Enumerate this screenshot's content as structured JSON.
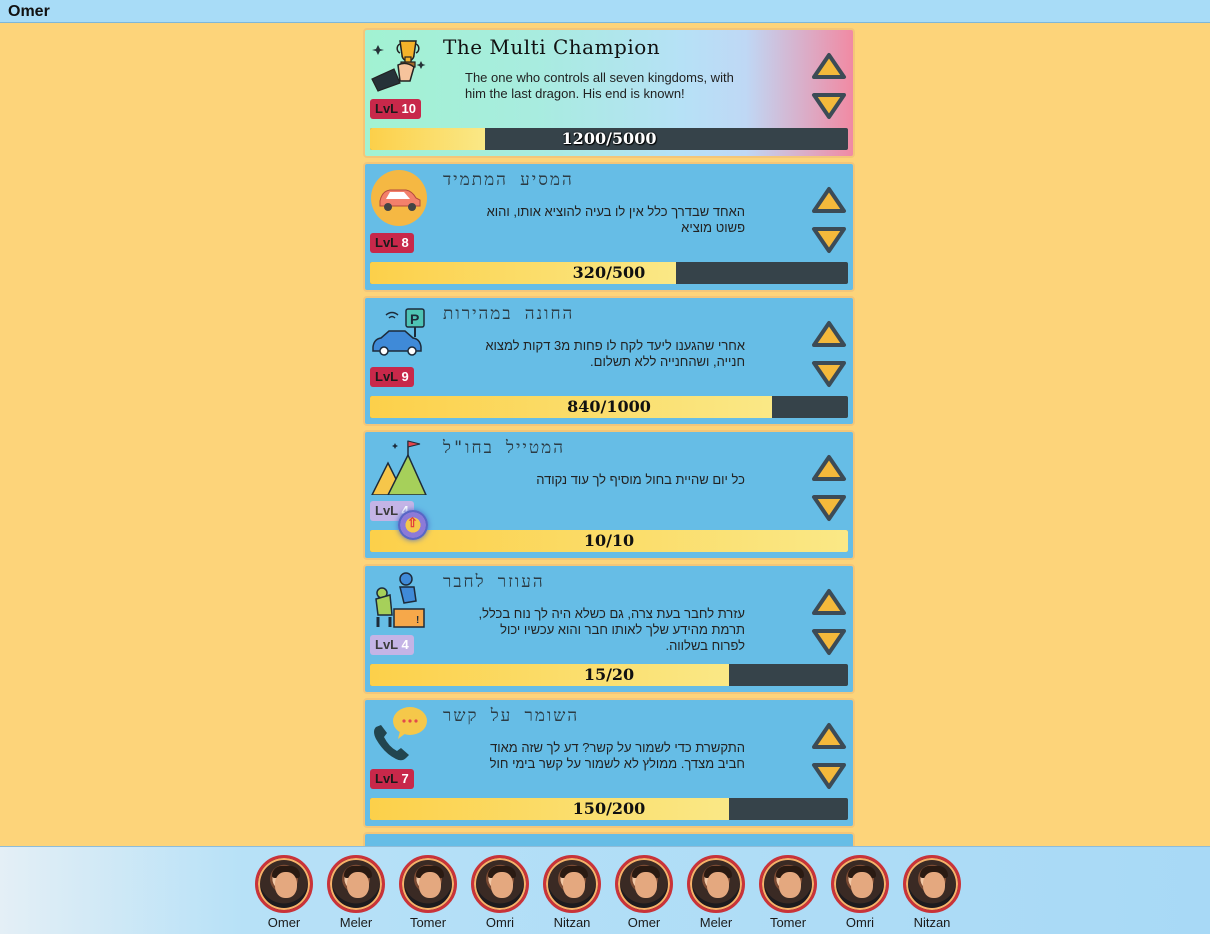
{
  "header": {
    "username": "Omer"
  },
  "achievements": [
    {
      "title": "The Multi Champion",
      "description": "The one who controls all seven kingdoms, with him the last dragon. His end is known!",
      "level_word": "LvL",
      "level": "10",
      "progress_text": "1200/5000",
      "progress": 0.24,
      "icon": "trophy-icon",
      "style": "champion"
    },
    {
      "title": "המסיע המתמיד",
      "description": "האחד שבדרך כלל אין לו בעיה להוציא אותו, והוא פשוט מוציא",
      "level_word": "LvL",
      "level": "8",
      "progress_text": "320/500",
      "progress": 0.64,
      "icon": "car-icon",
      "style": "normal"
    },
    {
      "title": "החונה במהירות",
      "description": "אחרי שהגענו ליעד לקח לו פחות מ3 דקות למצוא חנייה, ושהחנייה ללא תשלום.",
      "level_word": "LvL",
      "level": "9",
      "progress_text": "840/1000",
      "progress": 0.84,
      "icon": "parking-car-icon",
      "style": "normal"
    },
    {
      "title": "המטייל בחו\"ל",
      "description": "כל יום שהיית בחול מוסיף לך עוד נקודה",
      "level_word": "LvL",
      "level": "4",
      "progress_text": "10/10",
      "progress": 1.0,
      "icon": "mountain-flag-icon",
      "style": "done"
    },
    {
      "title": "העוזר לחבר",
      "description": "עזרת לחבר בעת צרה, גם כשלא היה לך נוח בכלל, תרמת מהידע שלך לאותו חבר והוא עכשיו יכול לפרוח בשלווה.",
      "level_word": "LvL",
      "level": "4",
      "progress_text": "15/20",
      "progress": 0.75,
      "icon": "helping-hand-icon",
      "style": "done"
    },
    {
      "title": "השומר על קשר",
      "description": "התקשרת כדי לשמור על קשר? דע לך שזה מאוד חביב מצדך. ממולץ לא לשמור על קשר בימי חול",
      "level_word": "LvL",
      "level": "7",
      "progress_text": "150/200",
      "progress": 0.75,
      "icon": "phone-chat-icon",
      "style": "normal"
    }
  ],
  "friends": [
    {
      "name": "Omer"
    },
    {
      "name": "Meler"
    },
    {
      "name": "Tomer"
    },
    {
      "name": "Omri"
    },
    {
      "name": "Nitzan"
    },
    {
      "name": "Omer"
    },
    {
      "name": "Meler"
    },
    {
      "name": "Tomer"
    },
    {
      "name": "Omri"
    },
    {
      "name": "Nitzan"
    }
  ],
  "colors": {
    "background": "#fdd47a",
    "card": "#66bde6",
    "bar_empty": "#36434a",
    "bar_fill": "#fcd04a",
    "level_badge": "#c8284a",
    "arrow_fill": "#f4b93b",
    "arrow_stroke": "#3c4b56"
  }
}
